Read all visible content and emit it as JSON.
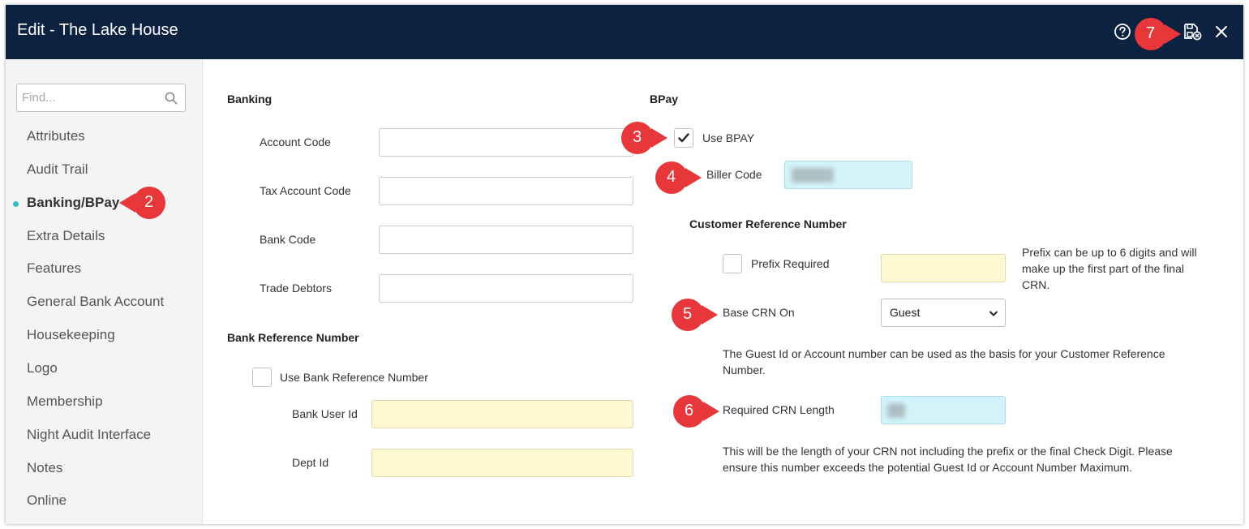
{
  "window": {
    "title": "Edit - The Lake House"
  },
  "sidebar": {
    "search_placeholder": "Find...",
    "items": [
      {
        "label": "Attributes"
      },
      {
        "label": "Audit Trail"
      },
      {
        "label": "Banking/BPay",
        "active": true
      },
      {
        "label": "Extra Details"
      },
      {
        "label": "Features"
      },
      {
        "label": "General Bank Account"
      },
      {
        "label": "Housekeeping"
      },
      {
        "label": "Logo"
      },
      {
        "label": "Membership"
      },
      {
        "label": "Night Audit Interface"
      },
      {
        "label": "Notes"
      },
      {
        "label": "Online"
      }
    ]
  },
  "banking": {
    "heading": "Banking",
    "account_code_label": "Account Code",
    "account_code_value": "",
    "tax_account_code_label": "Tax Account Code",
    "tax_account_code_value": "",
    "bank_code_label": "Bank Code",
    "bank_code_value": "",
    "trade_debtors_label": "Trade Debtors",
    "trade_debtors_value": ""
  },
  "bank_reference": {
    "heading": "Bank Reference Number",
    "use_label": "Use Bank Reference Number",
    "use_checked": false,
    "bank_user_id_label": "Bank User Id",
    "dept_id_label": "Dept Id"
  },
  "bpay": {
    "heading": "BPay",
    "use_label": "Use BPAY",
    "use_checked": true,
    "biller_code_label": "Biller Code"
  },
  "crn": {
    "heading": "Customer Reference Number",
    "prefix_required_label": "Prefix Required",
    "prefix_required_checked": false,
    "prefix_help": "Prefix can be up to 6 digits and will make up the first part of the final CRN.",
    "base_crn_label": "Base CRN On",
    "base_crn_value": "Guest",
    "base_help": "The Guest Id or Account number can be used as the basis for your Customer Reference Number.",
    "length_label": "Required CRN Length",
    "length_help": "This will be the length of your CRN not including the prefix or the final Check Digit. Please ensure this number exceeds the potential Guest Id or Account Number Maximum."
  },
  "callouts": [
    "2",
    "3",
    "4",
    "5",
    "6",
    "7"
  ],
  "colors": {
    "titlebar": "#0d2240",
    "callout": "#e8373a",
    "active_dot": "#33bcc9",
    "yellow_field": "#fff8d2",
    "cyan_field": "#d3f3fb"
  }
}
